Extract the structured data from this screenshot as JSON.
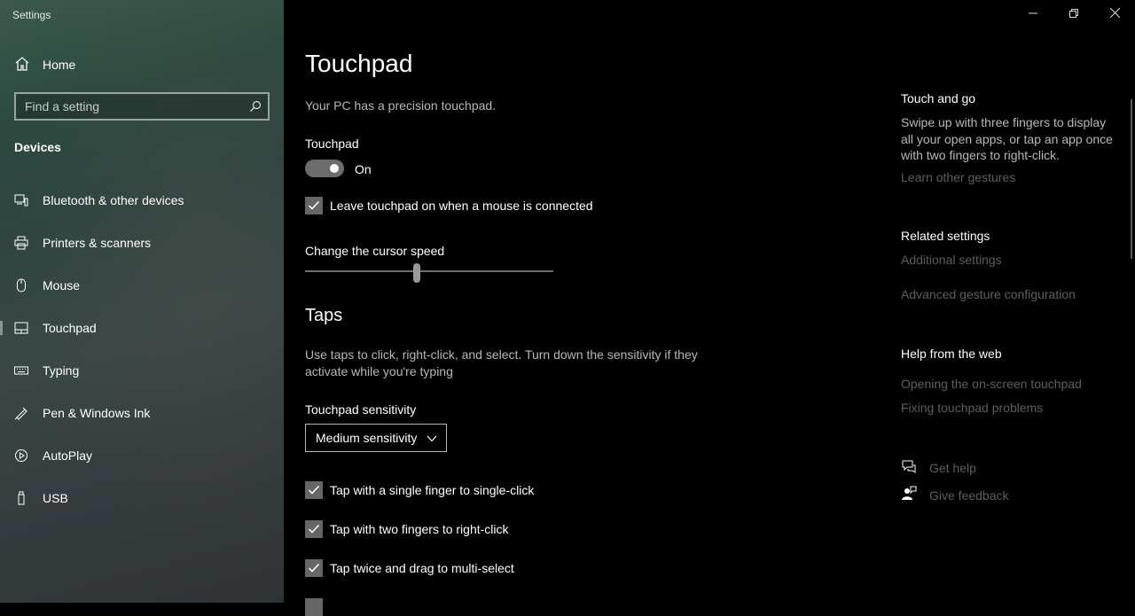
{
  "window": {
    "title": "Settings",
    "buttons": {
      "minimize": "minimize-icon",
      "maximize": "restore-icon",
      "close": "close-icon"
    }
  },
  "sidebar": {
    "home_label": "Home",
    "search_placeholder": "Find a setting",
    "section": "Devices",
    "items": [
      {
        "label": "Bluetooth & other devices",
        "icon": "bluetooth-devices-icon"
      },
      {
        "label": "Printers & scanners",
        "icon": "printer-icon"
      },
      {
        "label": "Mouse",
        "icon": "mouse-icon"
      },
      {
        "label": "Touchpad",
        "icon": "touchpad-icon",
        "selected": true
      },
      {
        "label": "Typing",
        "icon": "keyboard-icon"
      },
      {
        "label": "Pen & Windows Ink",
        "icon": "pen-icon"
      },
      {
        "label": "AutoPlay",
        "icon": "autoplay-icon"
      },
      {
        "label": "USB",
        "icon": "usb-icon"
      }
    ]
  },
  "main": {
    "title": "Touchpad",
    "precision_note": "Your PC has a precision touchpad.",
    "touchpad_label": "Touchpad",
    "toggle_state": "On",
    "leave_on_label": "Leave touchpad on when a mouse is connected",
    "cursor_speed_label": "Change the cursor speed",
    "cursor_speed_fraction": 0.45,
    "taps_heading": "Taps",
    "taps_desc_line1": "Use taps to click, right-click, and select. Turn down the sensitivity if they",
    "taps_desc_line2": "activate while you're typing",
    "sensitivity_label": "Touchpad sensitivity",
    "sensitivity_value": "Medium sensitivity",
    "tap_options": [
      "Tap with a single finger to single-click",
      "Tap with two fingers to right-click",
      "Tap twice and drag to multi-select"
    ]
  },
  "right": {
    "touch_heading": "Touch and go",
    "touch_desc": "Swipe up with three fingers to display all your open apps, or tap an app once with two fingers to right-click.",
    "learn_link": "Learn other gestures",
    "related_heading": "Related settings",
    "additional_link": "Additional settings",
    "advanced_link": "Advanced gesture configuration",
    "help_heading": "Help from the web",
    "help_link1": "Opening the on-screen touchpad",
    "help_link2": "Fixing touchpad problems",
    "get_help": "Get help",
    "give_feedback": "Give feedback"
  },
  "colors": {
    "background": "#000000",
    "muted_link": "#5e5e5e",
    "secondary_text": "#b7b7b7"
  }
}
